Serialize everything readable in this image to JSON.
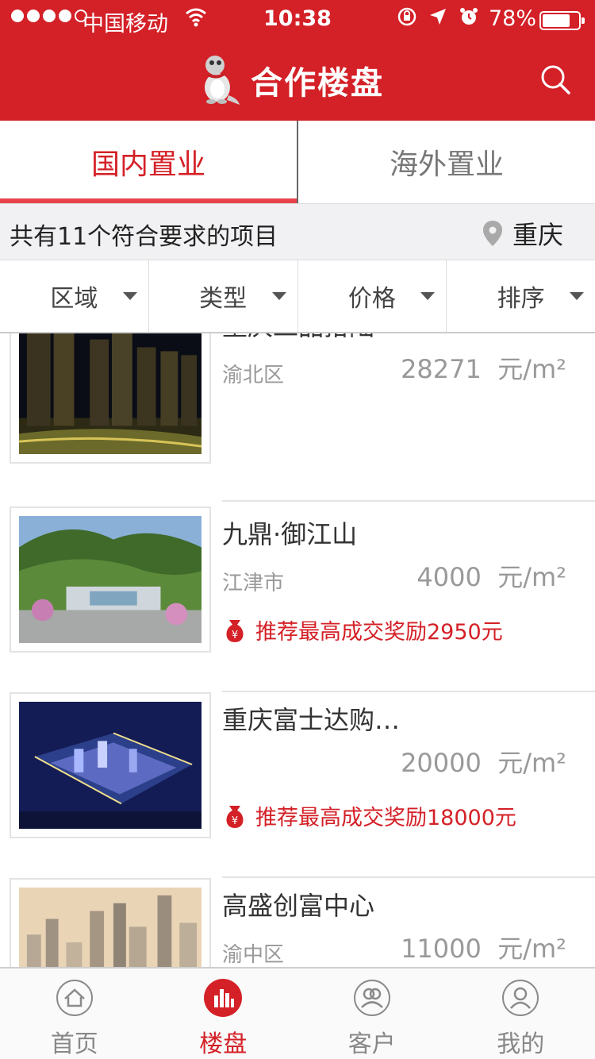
{
  "status_bar": {
    "carrier": "中国移动",
    "time": "10:38",
    "battery": "78%",
    "battery_level": 0.78
  },
  "header": {
    "title": "合作楼盘",
    "search_icon": "search-icon",
    "mascot_icon": "dinosaur-mascot-icon"
  },
  "tabs": [
    {
      "label": "国内置业",
      "active": true
    },
    {
      "label": "海外置业",
      "active": false
    }
  ],
  "result_bar": {
    "count_text": "共有11个符合要求的项目",
    "city": "重庆"
  },
  "filters": [
    {
      "label": "区域"
    },
    {
      "label": "类型"
    },
    {
      "label": "价格"
    },
    {
      "label": "排序"
    }
  ],
  "projects": [
    {
      "name": "重庆工品拾陆",
      "district": "渝北区",
      "price": "28271",
      "unit": "元/m²",
      "reward": ""
    },
    {
      "name": "九鼎·御江山",
      "district": "江津市",
      "price": "4000",
      "unit": "元/m²",
      "reward": "推荐最高成交奖励2950元"
    },
    {
      "name": "重庆富士达购…",
      "district": "",
      "price": "20000",
      "unit": "元/m²",
      "reward": "推荐最高成交奖励18000元"
    },
    {
      "name": "高盛创富中心",
      "district": "渝中区",
      "price": "11000",
      "unit": "元/m²",
      "reward": ""
    }
  ],
  "tabbar": [
    {
      "label": "首页",
      "icon": "home-icon",
      "active": false
    },
    {
      "label": "楼盘",
      "icon": "buildings-chart-icon",
      "active": true
    },
    {
      "label": "客户",
      "icon": "customers-icon",
      "active": false
    },
    {
      "label": "我的",
      "icon": "profile-icon",
      "active": false
    }
  ],
  "colors": {
    "brand_red": "#d42027",
    "tab_underline": "#e8434b",
    "muted_text": "#999999"
  }
}
